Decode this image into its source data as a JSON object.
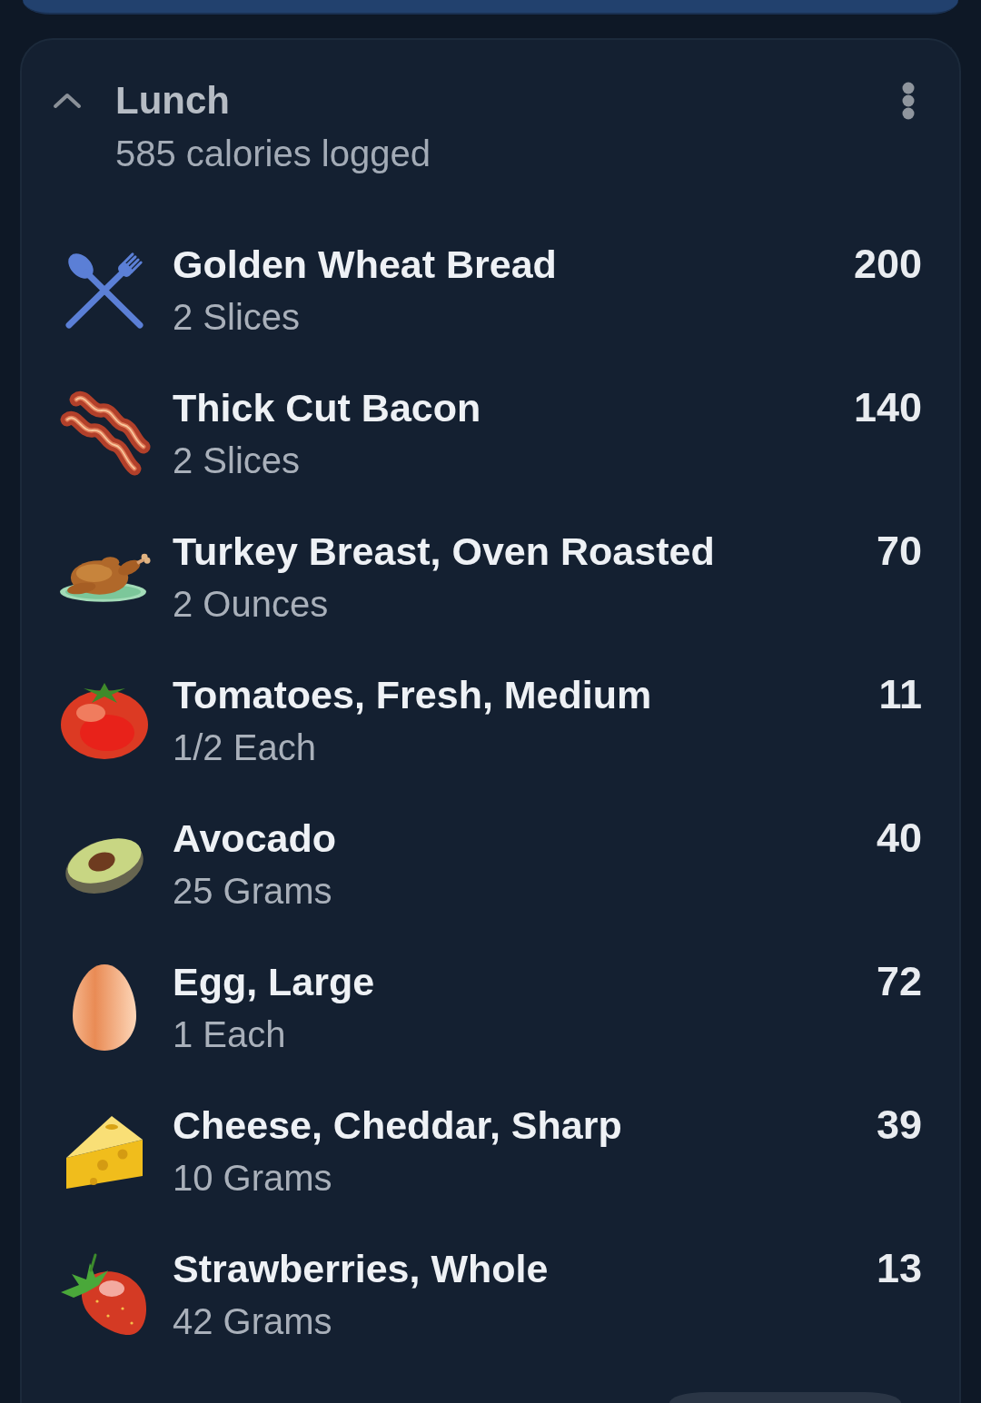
{
  "meal": {
    "title": "Lunch",
    "subtitle": "585 calories logged",
    "expanded": true
  },
  "items": [
    {
      "name": "Golden Wheat Bread",
      "serving": "2 Slices",
      "calories": "200"
    },
    {
      "name": "Thick Cut Bacon",
      "serving": "2 Slices",
      "calories": "140"
    },
    {
      "name": "Turkey Breast, Oven Roasted",
      "serving": "2 Ounces",
      "calories": "70"
    },
    {
      "name": "Tomatoes, Fresh, Medium",
      "serving": "1/2 Each",
      "calories": "11"
    },
    {
      "name": "Avocado",
      "serving": "25 Grams",
      "calories": "40"
    },
    {
      "name": "Egg, Large",
      "serving": "1 Each",
      "calories": "72"
    },
    {
      "name": "Cheese, Cheddar, Sharp",
      "serving": "10 Grams",
      "calories": "39"
    },
    {
      "name": "Strawberries, Whole",
      "serving": "42 Grams",
      "calories": "13"
    }
  ]
}
